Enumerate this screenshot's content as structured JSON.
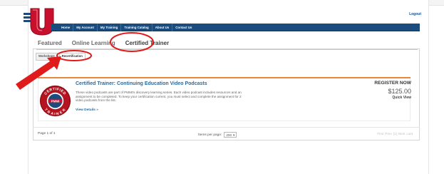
{
  "header": {
    "logout_label": "Logout"
  },
  "nav": {
    "items": [
      {
        "label": "Home"
      },
      {
        "label": "My Account"
      },
      {
        "label": "My Training"
      },
      {
        "label": "Training Catalog"
      },
      {
        "label": "About Us"
      },
      {
        "label": "Contact Us"
      }
    ]
  },
  "main_tabs": [
    {
      "label": "Featured",
      "active": false
    },
    {
      "label": "Online Learning",
      "active": false
    },
    {
      "label": "Certified Trainer",
      "active": true
    }
  ],
  "sub_tabs": [
    {
      "label": "Workshops",
      "active": false
    },
    {
      "label": "Recertification",
      "active": true
    }
  ],
  "item": {
    "title": "Certified Trainer: Continuing Education Video Podcasts",
    "description": "These video podcasts are part of PMMI's discovery learning series. Each video podcast includes resources and an assignment to be completed. To keep your certification current, you must select and complete the assignment for 2 video podcasts from the list.",
    "view_details": "View Details »",
    "register_label": "REGISTER NOW",
    "price": "$125.00",
    "quick_view": "Quick View",
    "badge": {
      "top_text": "CERTIFIED",
      "bottom_text": "TRAINER",
      "center_text": "PMMI"
    }
  },
  "pager": {
    "page_info": "Page 1 of 1",
    "items_per_page_label": "Items per page:",
    "items_per_page_value": "200",
    "first": "First",
    "prev": "Prev",
    "current": "[1]",
    "next": "Next",
    "last": "Last"
  },
  "colors": {
    "nav_bg": "#1b4c7e",
    "accent_orange": "#e8863a",
    "link_blue": "#2e6a9a",
    "logo_red": "#c8102e",
    "annotation_red": "#e01b1b"
  }
}
